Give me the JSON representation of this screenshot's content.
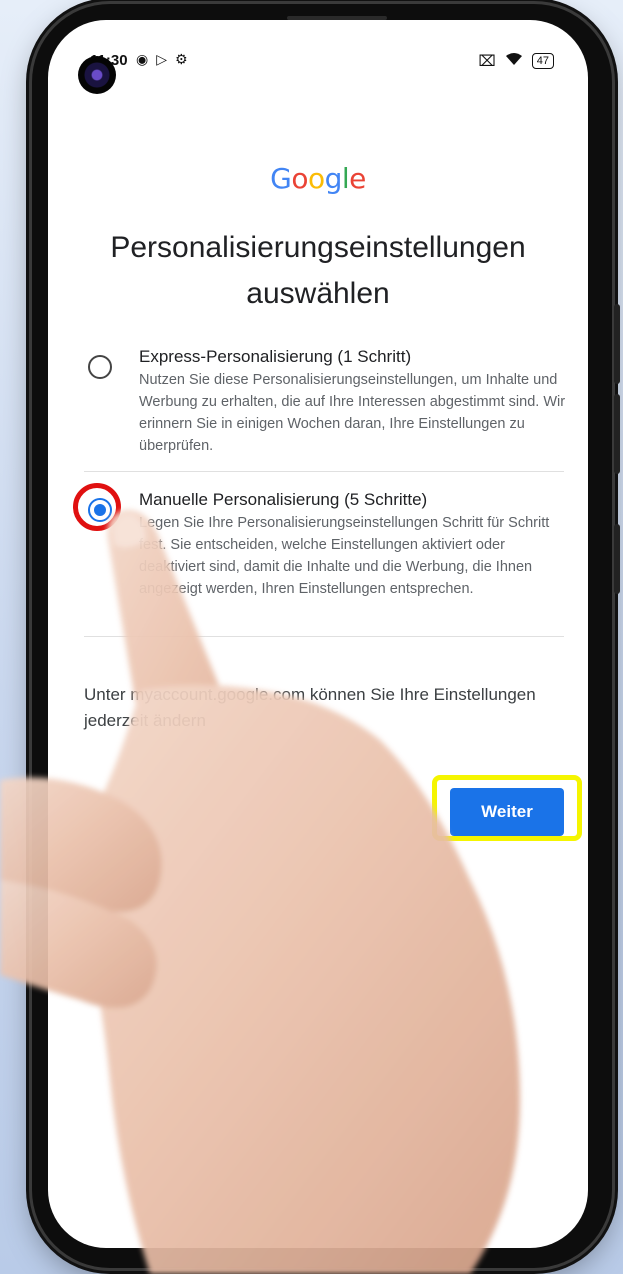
{
  "status_bar": {
    "time": "11:30",
    "battery": "47",
    "left_icons": [
      "notification-icon",
      "play-store-icon",
      "settings-icon"
    ],
    "right_icons": [
      "mute-icon",
      "wifi-icon",
      "battery-icon"
    ]
  },
  "brand": {
    "logo_text": "Google",
    "colors": {
      "blue": "#4285F4",
      "red": "#EA4335",
      "yellow": "#FBBC05",
      "green": "#34A853"
    }
  },
  "page": {
    "title": "Personalisierungseinstellungen auswählen"
  },
  "options": [
    {
      "title": "Express-Personalisierung (1 Schritt)",
      "description": "Nutzen Sie diese Personalisierungseinstellungen, um Inhalte und Werbung zu erhalten, die auf Ihre Interessen abgestimmt sind. Wir erinnern Sie in einigen Wochen daran, Ihre Einstellungen zu überprüfen.",
      "selected": false
    },
    {
      "title": "Manuelle Personalisierung (5 Schritte)",
      "description": "Legen Sie Ihre Personalisierungseinstellungen Schritt für Schritt fest. Sie entscheiden, welche Einstellungen aktiviert oder deaktiviert sind, damit die Inhalte und die Werbung, die Ihnen angezeigt werden, Ihren Einstellungen entsprechen.",
      "selected": true
    }
  ],
  "footer": {
    "text": "Unter myaccount.google.com können Sie Ihre Einstellungen jederzeit ändern"
  },
  "actions": {
    "next_label": "Weiter",
    "accent_color": "#1a73e8"
  },
  "annotations": {
    "radio_highlight_color": "#e01010",
    "button_highlight_color": "#f5f500"
  }
}
